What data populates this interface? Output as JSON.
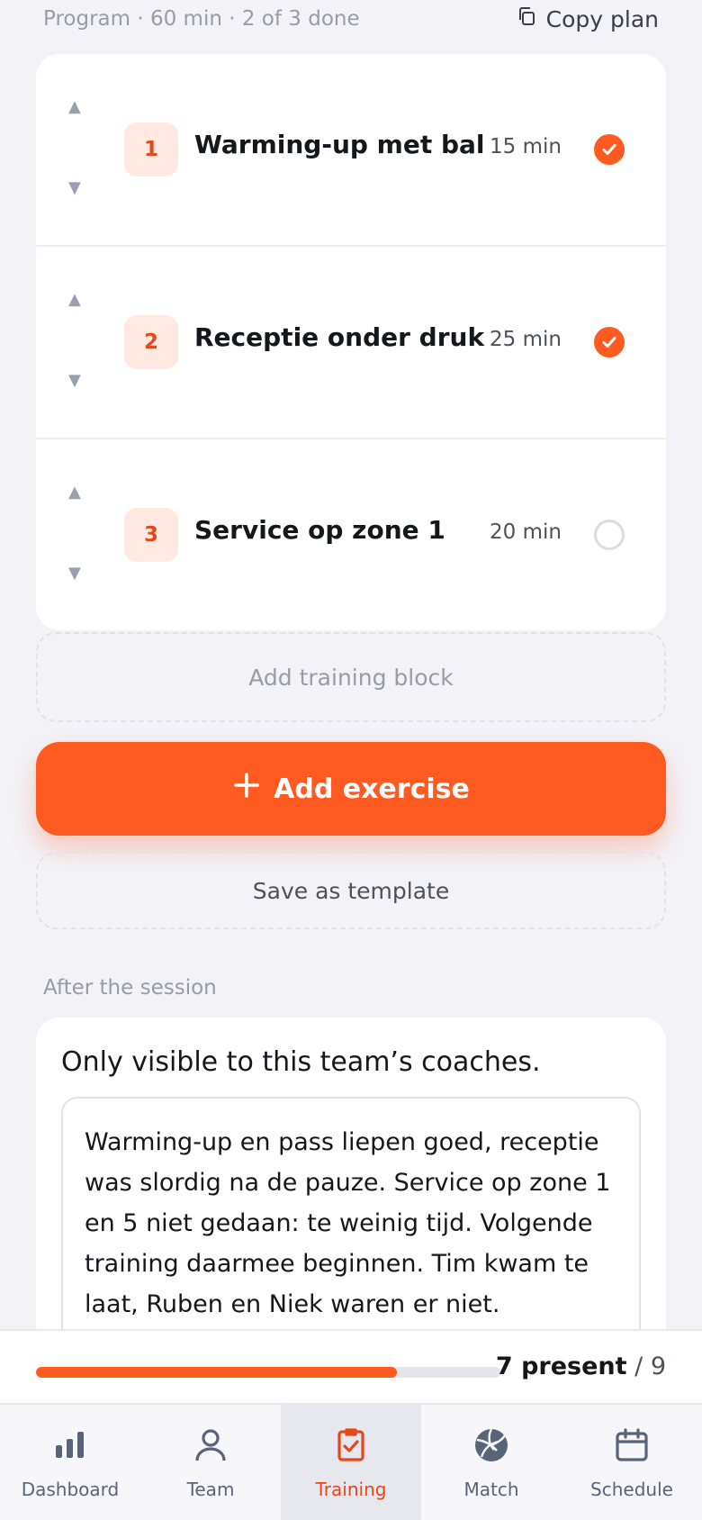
{
  "program": {
    "meta": "Program · 60 min · 2 of 3 done",
    "copy_label": "Copy plan",
    "exercises": [
      {
        "num": "1",
        "name": "Warming-up met bal",
        "duration": "15 min",
        "done": true
      },
      {
        "num": "2",
        "name": "Receptie onder druk",
        "duration": "25 min",
        "done": true
      },
      {
        "num": "3",
        "name": "Service op zone 1",
        "duration": "20 min",
        "done": false
      }
    ],
    "add_block_label": "Add training block",
    "add_exercise_label": "Add exercise",
    "save_template_label": "Save as template"
  },
  "after": {
    "label": "After the session",
    "hint": "Only visible to this team’s coaches.",
    "notes": "Warming-up en pass liepen goed, receptie was slordig na de pauze. Service op zone 1 en 5 niet gedaan: te weinig tijd. Volgende training daarmee beginnen. Tim kwam te laat, Ruben en Niek waren er niet."
  },
  "attendance": {
    "present_label": "7 present",
    "total_label": "/ 9",
    "fraction": 0.7778
  },
  "tabs": [
    {
      "label": "Dashboard",
      "icon": "bar-chart-icon",
      "active": false
    },
    {
      "label": "Team",
      "icon": "person-icon",
      "active": false
    },
    {
      "label": "Training",
      "icon": "clipboard-check-icon",
      "active": true
    },
    {
      "label": "Match",
      "icon": "volleyball-icon",
      "active": false
    },
    {
      "label": "Schedule",
      "icon": "calendar-icon",
      "active": false
    }
  ],
  "colors": {
    "accent": "#ff5a1f",
    "accent_text": "#e3481c",
    "background": "#f2f2f7"
  }
}
